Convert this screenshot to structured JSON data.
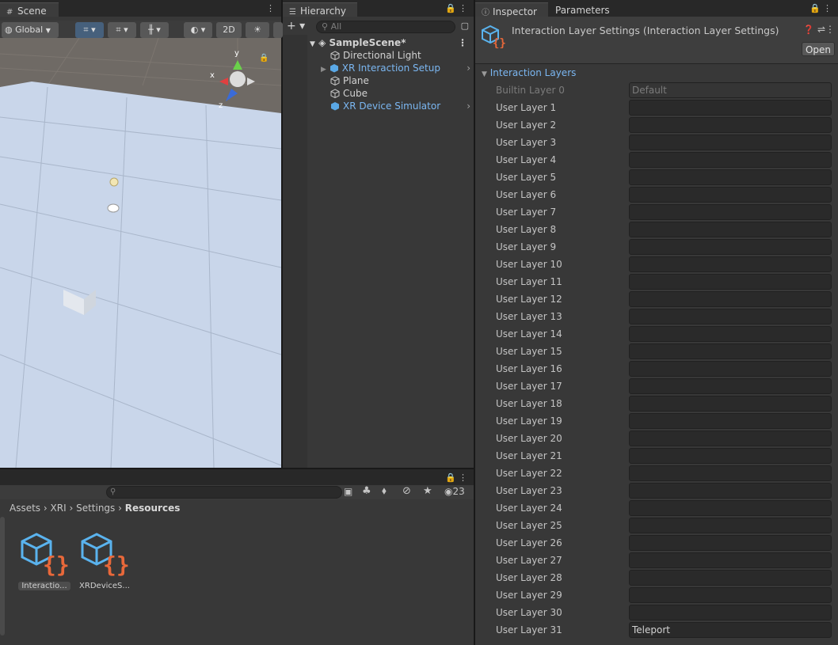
{
  "scene": {
    "tab_label": "Scene",
    "global_label": "Global",
    "mode_2d": "2D",
    "gizmo_axes": {
      "x": "x",
      "y": "y",
      "z": "z"
    }
  },
  "hierarchy": {
    "tab_label": "Hierarchy",
    "search_placeholder": "All",
    "scene_name": "SampleScene*",
    "items": [
      {
        "label": "Directional Light"
      },
      {
        "label": "XR Interaction Setup"
      },
      {
        "label": "Plane"
      },
      {
        "label": "Cube"
      },
      {
        "label": "XR Device Simulator"
      }
    ]
  },
  "project": {
    "visible_count": "23",
    "breadcrumb": [
      "Assets",
      "XRI",
      "Settings",
      "Resources"
    ],
    "assets": [
      {
        "label": "Interactio..."
      },
      {
        "label": "XRDeviceS..."
      }
    ]
  },
  "inspector": {
    "tab_label": "Inspector",
    "tab2_label": "Parameters",
    "title": "Interaction Layer Settings (Interaction Layer Settings)",
    "open_label": "Open",
    "section_label": "Interaction Layers",
    "layers": [
      {
        "label": "Builtin Layer 0",
        "value": "Default"
      },
      {
        "label": "User Layer 1",
        "value": ""
      },
      {
        "label": "User Layer 2",
        "value": ""
      },
      {
        "label": "User Layer 3",
        "value": ""
      },
      {
        "label": "User Layer 4",
        "value": ""
      },
      {
        "label": "User Layer 5",
        "value": ""
      },
      {
        "label": "User Layer 6",
        "value": ""
      },
      {
        "label": "User Layer 7",
        "value": ""
      },
      {
        "label": "User Layer 8",
        "value": ""
      },
      {
        "label": "User Layer 9",
        "value": ""
      },
      {
        "label": "User Layer 10",
        "value": ""
      },
      {
        "label": "User Layer 11",
        "value": ""
      },
      {
        "label": "User Layer 12",
        "value": ""
      },
      {
        "label": "User Layer 13",
        "value": ""
      },
      {
        "label": "User Layer 14",
        "value": ""
      },
      {
        "label": "User Layer 15",
        "value": ""
      },
      {
        "label": "User Layer 16",
        "value": ""
      },
      {
        "label": "User Layer 17",
        "value": ""
      },
      {
        "label": "User Layer 18",
        "value": ""
      },
      {
        "label": "User Layer 19",
        "value": ""
      },
      {
        "label": "User Layer 20",
        "value": ""
      },
      {
        "label": "User Layer 21",
        "value": ""
      },
      {
        "label": "User Layer 22",
        "value": ""
      },
      {
        "label": "User Layer 23",
        "value": ""
      },
      {
        "label": "User Layer 24",
        "value": ""
      },
      {
        "label": "User Layer 25",
        "value": ""
      },
      {
        "label": "User Layer 26",
        "value": ""
      },
      {
        "label": "User Layer 27",
        "value": ""
      },
      {
        "label": "User Layer 28",
        "value": ""
      },
      {
        "label": "User Layer 29",
        "value": ""
      },
      {
        "label": "User Layer 30",
        "value": ""
      },
      {
        "label": "User Layer 31",
        "value": "Teleport"
      }
    ]
  },
  "colors": {
    "accent_blue": "#7bb7f2",
    "asset_orange": "#e8683a",
    "panel_bg": "#383838",
    "field_bg": "#2a2a2a"
  }
}
